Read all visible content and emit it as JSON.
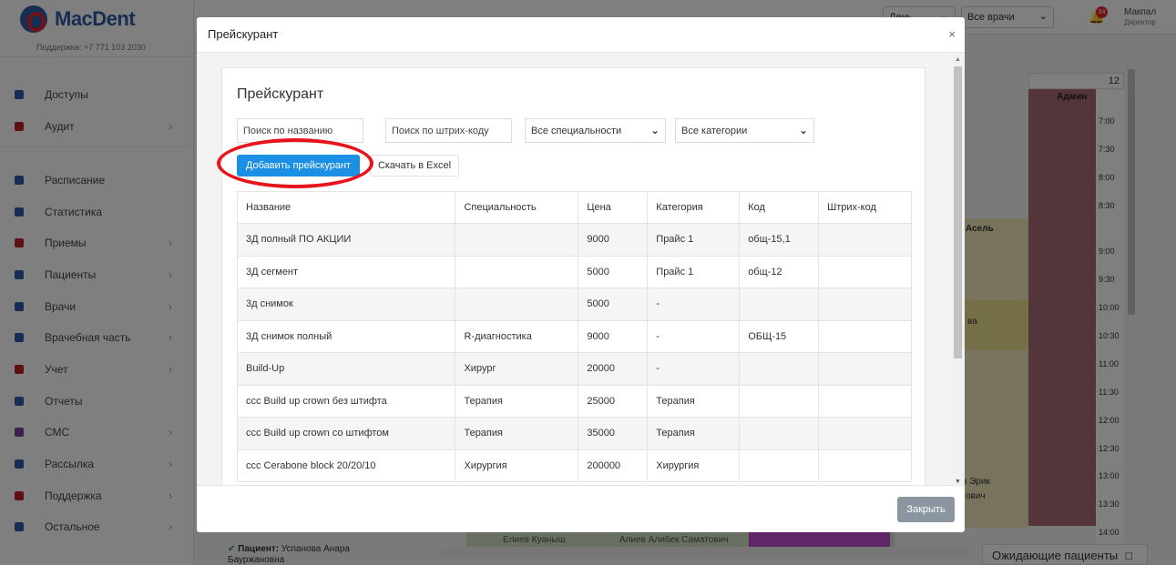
{
  "app": {
    "logo_text": "MacDent",
    "support": "Поддержка: +7 771 103 2030"
  },
  "sidebar": {
    "items": [
      {
        "label": "Доступы",
        "icon": "gear-icon",
        "color": "#2f5aa8",
        "chevron": false
      },
      {
        "label": "Аудит",
        "icon": "audit-icon",
        "color": "#c0202a",
        "chevron": true
      },
      {
        "label": "Расписание",
        "icon": "calendar-icon",
        "color": "#2f5aa8",
        "chevron": false
      },
      {
        "label": "Статистика",
        "icon": "chart-icon",
        "color": "#2f5aa8",
        "chevron": false
      },
      {
        "label": "Приемы",
        "icon": "appointments-icon",
        "color": "#c0202a",
        "chevron": true
      },
      {
        "label": "Пациенты",
        "icon": "patients-icon",
        "color": "#2f5aa8",
        "chevron": true
      },
      {
        "label": "Врачи",
        "icon": "doctor-icon",
        "color": "#2f5aa8",
        "chevron": true
      },
      {
        "label": "Врачебная часть",
        "icon": "medical-icon",
        "color": "#2f5aa8",
        "chevron": true
      },
      {
        "label": "Учет",
        "icon": "accounting-icon",
        "color": "#c0202a",
        "chevron": true
      },
      {
        "label": "Отчеты",
        "icon": "reports-icon",
        "color": "#2f5aa8",
        "chevron": false
      },
      {
        "label": "СМС",
        "icon": "sms-icon",
        "color": "#7a3ea3",
        "chevron": true
      },
      {
        "label": "Рассылка",
        "icon": "mailing-icon",
        "color": "#2f5aa8",
        "chevron": true
      },
      {
        "label": "Поддержка",
        "icon": "question-icon",
        "color": "#c0202a",
        "chevron": true
      },
      {
        "label": "Остальное",
        "icon": "more-icon",
        "color": "#2f5aa8",
        "chevron": true
      }
    ]
  },
  "topbar": {
    "view_select": "День",
    "doctor_select": "Все врачи",
    "notifications_count": "24",
    "user_name": "Макпал",
    "user_role": "Директор"
  },
  "schedule": {
    "column_number": "12",
    "admin_label": "Админ",
    "times": [
      "7:00",
      "7:30",
      "8:00",
      "8:30",
      "9:00",
      "9:30",
      "10:00",
      "10:30",
      "11:00",
      "11:30",
      "12:00",
      "12:30",
      "13:00",
      "13:30",
      "14:00"
    ],
    "cell_asel": "Асель",
    "cell_va": "ва",
    "cell_erik": "в Эрик",
    "cell_ovich": "ович",
    "bottom_left": "Елиев Куаныш",
    "bottom_mid": "Алиев Алибек Саматович",
    "waiting_patients": "Ожидающие пациенты",
    "patient_label": "Пациент:",
    "patient_name": "Успанова Анара",
    "patient_name2": "Бауржановна"
  },
  "modal": {
    "title": "Прейскурант",
    "close_symbol": "×",
    "card_title": "Прейскурант",
    "search_name_placeholder": "Поиск по названию",
    "search_barcode_placeholder": "Поиск по штрих-коду",
    "specialty_select": "Все специальности",
    "category_select": "Все категории",
    "add_button": "Добавить прейскурант",
    "excel_button": "Скачать в Excel",
    "close_button": "Закрыть",
    "table": {
      "headers": [
        "Название",
        "Специальность",
        "Цена",
        "Категория",
        "Код",
        "Штрих-код"
      ],
      "rows": [
        [
          "3Д полный ПО АКЦИИ",
          "",
          "9000",
          "Прайс 1",
          "общ-15,1",
          ""
        ],
        [
          "3Д сегмент",
          "",
          "5000",
          "Прайс 1",
          "общ-12",
          ""
        ],
        [
          "3д снимок",
          "",
          "5000",
          "-",
          "",
          ""
        ],
        [
          "3Д снимок полный",
          "R-диагностика",
          "9000",
          "-",
          "ОБЩ-15",
          ""
        ],
        [
          "Build-Up",
          "Хирург",
          "20000",
          "-",
          "",
          ""
        ],
        [
          "ccc Build up crown без штифта",
          "Терапия",
          "25000",
          "Терапия",
          "",
          ""
        ],
        [
          "ccc Build up crown со штифтом",
          "Терапия",
          "35000",
          "Терапия",
          "",
          ""
        ],
        [
          "ccc Cerabone block 20/20/10",
          "Хирургия",
          "200000",
          "Хирургия",
          "",
          ""
        ]
      ]
    }
  }
}
